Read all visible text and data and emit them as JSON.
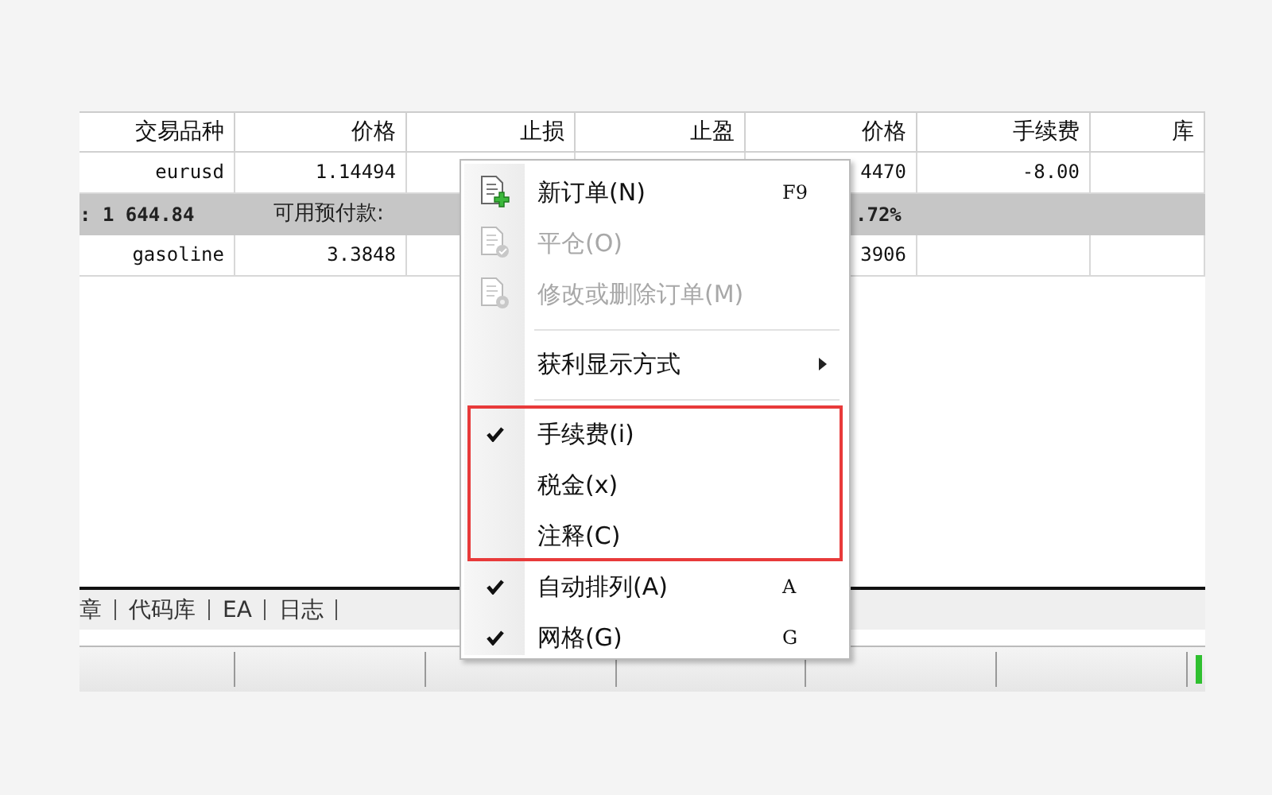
{
  "table": {
    "columns": [
      "交易品种",
      "价格",
      "止损",
      "止盈",
      "价格",
      "手续费",
      "库"
    ],
    "rows": [
      {
        "kind": "order",
        "cells": [
          "eurusd",
          "1.14494",
          "",
          "",
          "4470",
          "-8.00",
          ""
        ]
      },
      {
        "kind": "summary",
        "parts": [
          ": 1 644.84",
          "可用预付款:",
          ".72%"
        ]
      },
      {
        "kind": "order",
        "cells": [
          "gasoline",
          "3.3848",
          "",
          "",
          "3906",
          "",
          ""
        ]
      }
    ]
  },
  "tabs": [
    "章",
    "代码库",
    "EA",
    "日志"
  ],
  "context_menu": {
    "items": [
      {
        "kind": "item",
        "label": "新订单(N)",
        "shortcut": "F9",
        "disabled": false,
        "checked": false,
        "highlighted": false
      },
      {
        "kind": "item",
        "label": "平仓(O)",
        "disabled": true,
        "checked": false,
        "highlighted": false
      },
      {
        "kind": "item",
        "label": "修改或删除订单(M)",
        "disabled": true,
        "checked": false,
        "highlighted": false
      },
      {
        "kind": "separator"
      },
      {
        "kind": "item",
        "label": "获利显示方式",
        "submenu": true,
        "disabled": false,
        "checked": false,
        "highlighted": false
      },
      {
        "kind": "separator"
      },
      {
        "kind": "item",
        "label": "手续费(i)",
        "disabled": false,
        "checked": true,
        "highlighted": true
      },
      {
        "kind": "item",
        "label": "税金(x)",
        "disabled": false,
        "checked": false,
        "highlighted": true
      },
      {
        "kind": "item",
        "label": "注释(C)",
        "disabled": false,
        "checked": false,
        "highlighted": true
      },
      {
        "kind": "item",
        "label": "自动排列(A)",
        "shortcut": "A",
        "disabled": false,
        "checked": true,
        "highlighted": false
      },
      {
        "kind": "item",
        "label": "网格(G)",
        "shortcut": "G",
        "disabled": false,
        "checked": true,
        "highlighted": false
      }
    ]
  }
}
